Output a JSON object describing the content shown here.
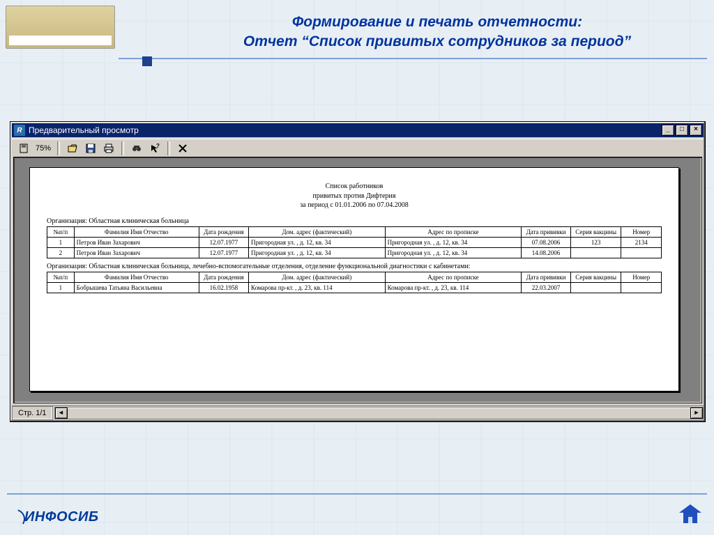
{
  "slide": {
    "headline_1": "Формирование и печать отчетности:",
    "headline_2": "Отчет “Список привитых сотрудников за период”",
    "footer_logo": "ИНФОСИБ"
  },
  "window": {
    "title": "Предварительный просмотр",
    "zoom": "75%",
    "status": "Стр. 1/1"
  },
  "report": {
    "title_l1": "Список    работников",
    "title_l2": "привитых против  Дифтерия",
    "title_l3": "за период   с  01.01.2006 по 07.04.2008",
    "columns": [
      "№п/п",
      "Фамилия Имя Отчество",
      "Дата рождения",
      "Дом. адрес (фактический)",
      "Адрес по прописке",
      "Дата прививки",
      "Серия вакцины",
      "Номер"
    ],
    "groups": [
      {
        "org": "Организация:  Областная  клиническая  больница",
        "rows": [
          {
            "n": "1",
            "fio": "Петров  Иван  Захарович",
            "dob": "12.07.1977",
            "addr_f": "Пригородная ул. , д. 12, кв. 34",
            "addr_r": "Пригородная ул. , д. 12, кв. 34",
            "vdate": "07.08.2006",
            "series": "123",
            "num": "2134"
          },
          {
            "n": "2",
            "fio": "Петров  Иван  Захарович",
            "dob": "12.07.1977",
            "addr_f": "Пригородная ул. , д. 12, кв. 34",
            "addr_r": "Пригородная ул. , д. 12, кв. 34",
            "vdate": "14.08.2006",
            "series": "",
            "num": ""
          }
        ]
      },
      {
        "org": "Организация:  Областная  клиническая  больница, лечебно-вспомогательные  отделения, отделение функциональной диагностики с кабинетами:",
        "rows": [
          {
            "n": "1",
            "fio": "Бобрышева  Татьяна  Васильевна",
            "dob": "16.02.1958",
            "addr_f": "Комарова пр-кт. , д. 23, кв. 114",
            "addr_r": "Комарова пр-кт. , д. 23, кв. 114",
            "vdate": "22.03.2007",
            "series": "",
            "num": ""
          }
        ]
      }
    ]
  }
}
